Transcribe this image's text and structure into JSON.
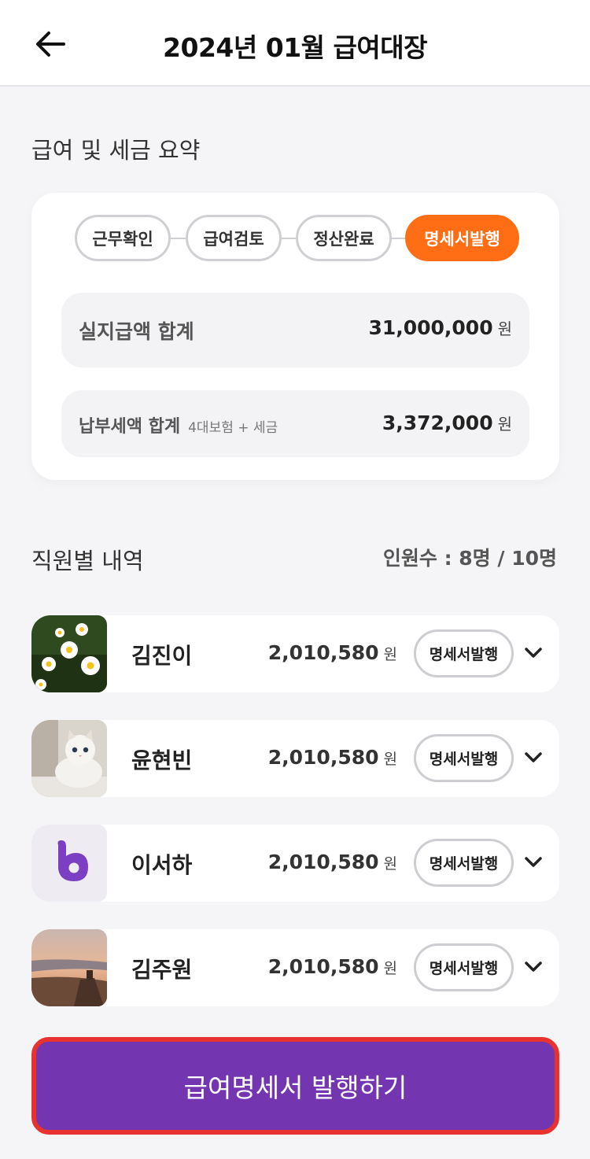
{
  "header": {
    "title": "2024년 01월 급여대장",
    "back_icon": "arrow-left-icon"
  },
  "summary": {
    "section_title": "급여 및 세금 요약",
    "steps": [
      {
        "label": "근무확인",
        "active": false
      },
      {
        "label": "급여검토",
        "active": false
      },
      {
        "label": "정산완료",
        "active": false
      },
      {
        "label": "명세서발행",
        "active": true
      }
    ],
    "net_pay": {
      "label": "실지급액 합계",
      "amount": "31,000,000",
      "unit": "원"
    },
    "tax": {
      "label": "납부세액 합계",
      "sub_label": "4대보험 + 세금",
      "amount": "3,372,000",
      "unit": "원"
    }
  },
  "employees": {
    "section_title": "직원별 내역",
    "count_text": "인원수 : 8명 / 10명",
    "items": [
      {
        "name": "김진이",
        "amount": "2,010,580",
        "unit": "원",
        "button": "명세서발행",
        "photo": "daisy-photo"
      },
      {
        "name": "윤현빈",
        "amount": "2,010,580",
        "unit": "원",
        "button": "명세서발행",
        "photo": "cat-photo"
      },
      {
        "name": "이서하",
        "amount": "2,010,580",
        "unit": "원",
        "button": "명세서발행",
        "photo": "b-logo"
      },
      {
        "name": "김주원",
        "amount": "2,010,580",
        "unit": "원",
        "button": "명세서발행",
        "photo": "beach-photo"
      }
    ]
  },
  "cta": {
    "label": "급여명세서 발행하기"
  },
  "colors": {
    "accent_orange": "#ff6e14",
    "primary_purple": "#7435b0",
    "highlight_red": "#e8322f"
  }
}
